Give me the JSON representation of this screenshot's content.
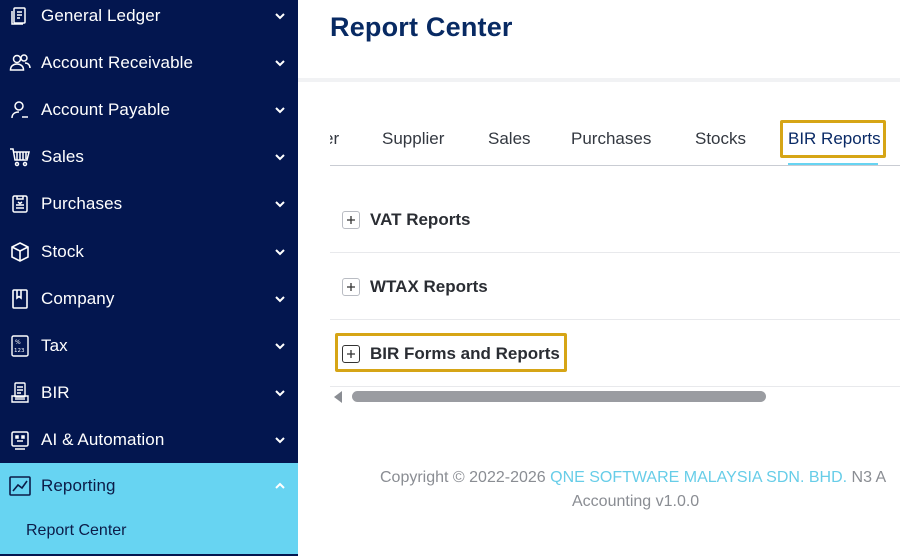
{
  "sidebar": {
    "items": [
      {
        "label": "General Ledger",
        "icon": "ledger-icon"
      },
      {
        "label": "Account Receivable",
        "icon": "users-icon"
      },
      {
        "label": "Account Payable",
        "icon": "user-icon"
      },
      {
        "label": "Sales",
        "icon": "cart-icon"
      },
      {
        "label": "Purchases",
        "icon": "clipboard-icon"
      },
      {
        "label": "Stock",
        "icon": "box-icon"
      },
      {
        "label": "Company",
        "icon": "book-icon"
      },
      {
        "label": "Tax",
        "icon": "tax-icon"
      },
      {
        "label": "BIR",
        "icon": "bir-icon"
      },
      {
        "label": "AI & Automation",
        "icon": "robot-icon"
      },
      {
        "label": "Reporting",
        "icon": "chart-icon"
      }
    ],
    "sub_item": "Report Center"
  },
  "page": {
    "title": "Report Center"
  },
  "tabs": [
    {
      "label": "er"
    },
    {
      "label": "Supplier"
    },
    {
      "label": "Sales"
    },
    {
      "label": "Purchases"
    },
    {
      "label": "Stocks"
    },
    {
      "label": "BIR Reports"
    }
  ],
  "sections": [
    {
      "label": "VAT Reports"
    },
    {
      "label": "WTAX Reports"
    },
    {
      "label": "BIR Forms and Reports"
    }
  ],
  "footer": {
    "prefix": "Copyright © 2022-2026 ",
    "company": "QNE SOFTWARE MALAYSIA SDN. BHD.",
    "suffix": " N3 A",
    "line2": "Accounting v1.0.0"
  },
  "colors": {
    "sidebar_bg": "#03164f",
    "accent": "#67d4f2",
    "highlight": "#d6a516",
    "title": "#082a63"
  }
}
